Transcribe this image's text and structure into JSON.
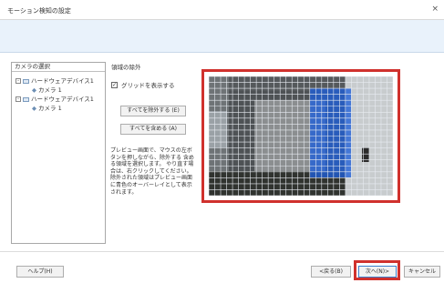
{
  "window": {
    "title": "モーション検知の設定",
    "close_glyph": "×"
  },
  "tree": {
    "header": "カメラの選択",
    "items": [
      {
        "label": "ハードウェアデバイス1",
        "icon": "device-icon",
        "expander": "-"
      },
      {
        "label": "カメラ 1",
        "icon": "camera-icon"
      },
      {
        "label": "ハードウェアデバイス1",
        "icon": "device-icon",
        "expander": "-"
      },
      {
        "label": "カメラ 1",
        "icon": "camera-icon"
      }
    ]
  },
  "region": {
    "section_label": "領域の除外",
    "grid_checkbox": {
      "label": "グリッドを表示する",
      "checked": true
    },
    "exclude_all_button": "すべてを除外する (E)",
    "include_all_button": "すべてを含める (A)",
    "description": "プレビュー画面で、マウスの左ボタンを押しながら、除外する 含める領域を選択します。 やり直す場合は、右クリックしてください。 除外された領域はプレビュー画面に青色のオーバーレイとして表示されます。",
    "grid": {
      "cols": 31,
      "rows": 20,
      "line_color": "#e8ecf2",
      "excluded_color": "#1f5fd8",
      "excluded_opacity": 0.78
    }
  },
  "footer": {
    "help_button": "ヘルプ(H)",
    "back_button": "<戻る(B)",
    "next_button": "次へ(N)>",
    "cancel_button": "キャンセル"
  },
  "colors": {
    "highlight": "#d0312d",
    "banner": "#e9f2fb"
  }
}
